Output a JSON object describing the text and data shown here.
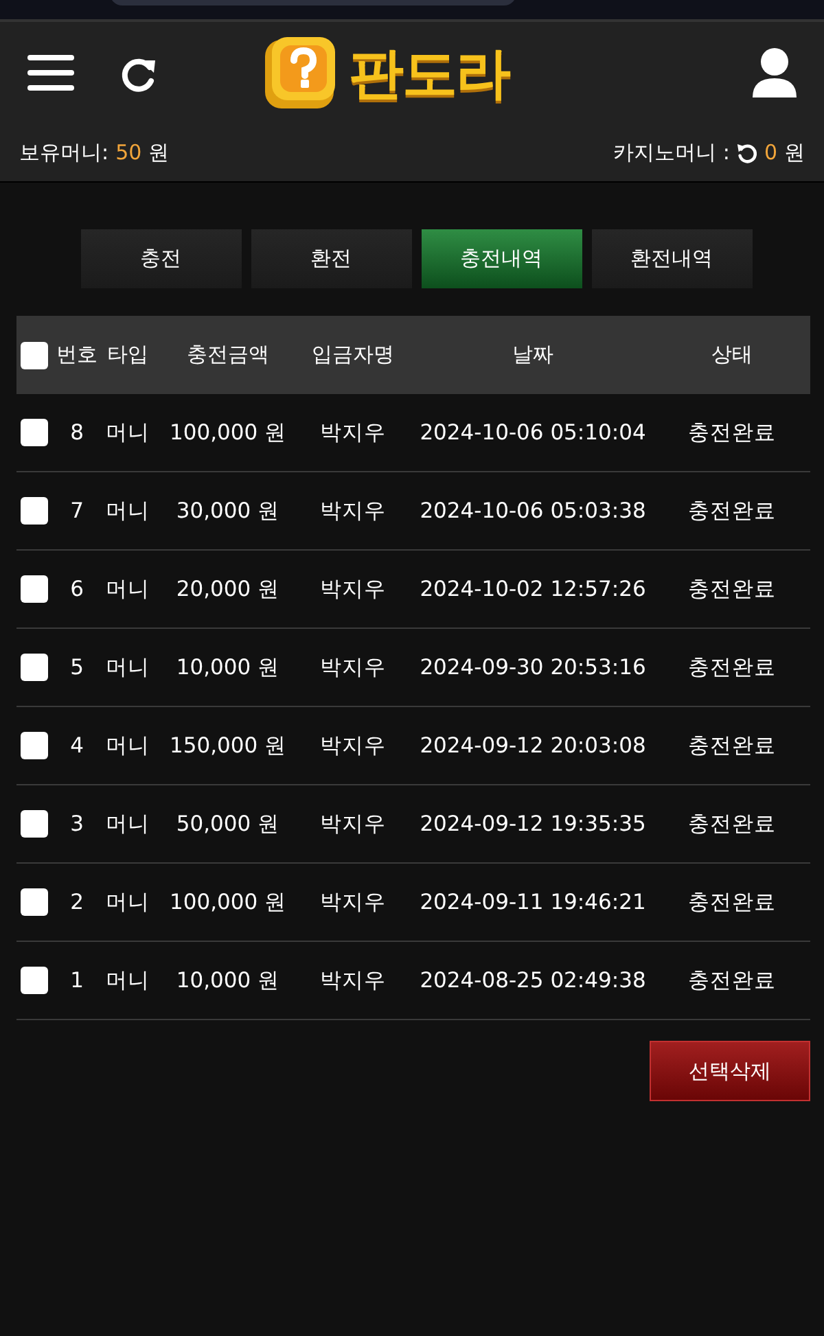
{
  "header": {
    "logo_text": "판도라",
    "balance_label": "보유머니:",
    "balance_value": "50",
    "balance_unit": "원",
    "casino_label": "카지노머니 :",
    "casino_value": "0",
    "casino_unit": "원"
  },
  "tabs": [
    {
      "label": "충전",
      "selected": false
    },
    {
      "label": "환전",
      "selected": false
    },
    {
      "label": "충전내역",
      "selected": true
    },
    {
      "label": "환전내역",
      "selected": false
    }
  ],
  "table": {
    "select_all_checked": false,
    "columns": [
      "번호",
      "타입",
      "충전금액",
      "입금자명",
      "날짜",
      "상태"
    ],
    "rows": [
      {
        "checked": false,
        "cells": [
          "8",
          "머니",
          "100,000 원",
          "박지우",
          "2024-10-06 05:10:04",
          "충전완료"
        ]
      },
      {
        "checked": false,
        "cells": [
          "7",
          "머니",
          "30,000 원",
          "박지우",
          "2024-10-06 05:03:38",
          "충전완료"
        ]
      },
      {
        "checked": false,
        "cells": [
          "6",
          "머니",
          "20,000 원",
          "박지우",
          "2024-10-02 12:57:26",
          "충전완료"
        ]
      },
      {
        "checked": false,
        "cells": [
          "5",
          "머니",
          "10,000 원",
          "박지우",
          "2024-09-30 20:53:16",
          "충전완료"
        ]
      },
      {
        "checked": false,
        "cells": [
          "4",
          "머니",
          "150,000 원",
          "박지우",
          "2024-09-12 20:03:08",
          "충전완료"
        ]
      },
      {
        "checked": false,
        "cells": [
          "3",
          "머니",
          "50,000 원",
          "박지우",
          "2024-09-12 19:35:35",
          "충전완료"
        ]
      },
      {
        "checked": false,
        "cells": [
          "2",
          "머니",
          "100,000 원",
          "박지우",
          "2024-09-11 19:46:21",
          "충전완료"
        ]
      },
      {
        "checked": false,
        "cells": [
          "1",
          "머니",
          "10,000 원",
          "박지우",
          "2024-08-25 02:49:38",
          "충전완료"
        ]
      }
    ]
  },
  "delete_button": "선택삭제"
}
